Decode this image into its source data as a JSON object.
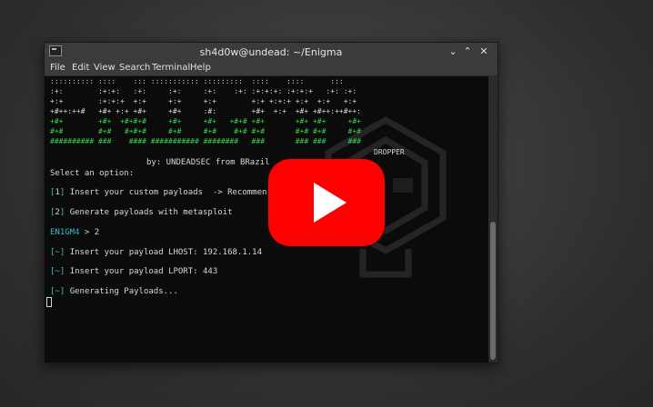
{
  "window": {
    "title": "sh4d0w@undead: ~/Enigma",
    "controls": {
      "minimize": "⌄",
      "maximize": "⌃",
      "close": "✕"
    }
  },
  "menubar": [
    "File",
    "Edit",
    "View",
    "Search",
    "Terminal",
    "Help"
  ],
  "terminal": {
    "banner": [
      {
        "text": ":::::::::: ::::    ::: ::::::::::: :::::::::  ::::    ::::      :::",
        "color": "w"
      },
      {
        "text": ":+:        :+:+:   :+:     :+:     :+:    :+: :+:+:+: :+:+:+   :+: :+:",
        "color": "w"
      },
      {
        "text": "+:+        :+:+:+  +:+     +:+     +:+        +:+ +:+:+ +:+  +:+   +:+",
        "color": "w"
      },
      {
        "text": "+#++:++#   +#+ +:+ +#+     +#+     :#:        +#+  +:+  +#+ +#++:++#++:",
        "color": "w"
      },
      {
        "text": "+#+        +#+  +#+#+#     +#+     +#+   +#+# +#+       +#+ +#+     +#+",
        "color": "g"
      },
      {
        "text": "#+#        #+#   #+#+#     #+#     #+#    #+# #+#       #+# #+#     #+#",
        "color": "g"
      },
      {
        "text": "########## ###    #### ########### ########   ###       ### ###     ###",
        "color": "g"
      }
    ],
    "dropper_label": "DROPPER",
    "credit": "by: UNDEADSEC from BRazil",
    "select_prompt": "Select an option:",
    "options": [
      {
        "num": "1",
        "text": "Insert your custom payloads  -> Recommen"
      },
      {
        "num": "2",
        "text": "Generate payloads with metasploit"
      }
    ],
    "prompt_label": "EN1GM4",
    "prompt_input": " > 2",
    "info_lines": [
      {
        "mark": "~",
        "text": "Insert your payload LHOST: 192.168.1.14"
      },
      {
        "mark": "~",
        "text": "Insert your payload LPORT: 443"
      },
      {
        "mark": "~",
        "text": "Generating Payloads..."
      }
    ]
  },
  "overlay": {
    "type": "video-play-button",
    "color": "#ff0000"
  },
  "icons": [
    "terminal-app-icon",
    "logo-watermark-icon",
    "play-button-icon"
  ]
}
